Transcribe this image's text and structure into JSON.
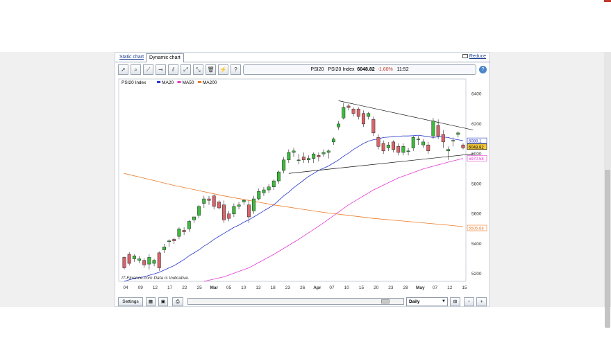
{
  "tabs": [
    {
      "label": "Static chart"
    },
    {
      "label": "Dynamic chart"
    }
  ],
  "reduce_label": "Reduce",
  "ticker": {
    "symbol": "PSI20",
    "name": "PSI20 Index",
    "price": "6048.82",
    "change": "-1.60%",
    "time": "11:52"
  },
  "bottom": {
    "settings_label": "Settings",
    "interval": "Daily"
  },
  "chart_data": {
    "type": "line",
    "legend": [
      "PSI20 Index",
      "MA20",
      "MA50",
      "MA200"
    ],
    "watermark": "IT-Finance.com Data is Indicative.",
    "colors": {
      "up": "#3dbb3d",
      "down": "#d9646a",
      "ma20": "#2535c8",
      "ma50": "#e23ad2",
      "ma200": "#ee7a25",
      "trend": "#111111"
    },
    "ylim": [
      5150,
      6500
    ],
    "yticks": [
      5200,
      5400,
      5600,
      5800,
      6000,
      6200,
      6400
    ],
    "xtick_labels": [
      "04",
      "09",
      "12",
      "17",
      "22",
      "25",
      "Mar",
      "05",
      "10",
      "13",
      "18",
      "23",
      "26",
      "Apr",
      "07",
      "10",
      "15",
      "20",
      "23",
      "28",
      "May",
      "07",
      "12",
      "15"
    ],
    "candles": [
      [
        5310,
        5240,
        5230,
        5315
      ],
      [
        5330,
        5270,
        5255,
        5345
      ],
      [
        5300,
        5320,
        5280,
        5330
      ],
      [
        5290,
        5300,
        5270,
        5320
      ],
      [
        5290,
        5260,
        5240,
        5305
      ],
      [
        5265,
        5310,
        5230,
        5330
      ],
      [
        5270,
        5290,
        5250,
        5300
      ],
      [
        5340,
        5240,
        5220,
        5350
      ],
      [
        5360,
        5380,
        5340,
        5400
      ],
      [
        5415,
        5420,
        5380,
        5430
      ],
      [
        5430,
        5420,
        5400,
        5440
      ],
      [
        5450,
        5500,
        5430,
        5510
      ],
      [
        5490,
        5480,
        5460,
        5510
      ],
      [
        5500,
        5550,
        5480,
        5560
      ],
      [
        5560,
        5580,
        5540,
        5580
      ],
      [
        5590,
        5650,
        5570,
        5660
      ],
      [
        5670,
        5700,
        5640,
        5720
      ],
      [
        5700,
        5690,
        5660,
        5720
      ],
      [
        5720,
        5650,
        5630,
        5730
      ],
      [
        5680,
        5640,
        5630,
        5690
      ],
      [
        5660,
        5560,
        5540,
        5690
      ],
      [
        5600,
        5570,
        5550,
        5620
      ],
      [
        5600,
        5650,
        5580,
        5670
      ],
      [
        5650,
        5660,
        5630,
        5680
      ],
      [
        5680,
        5690,
        5660,
        5700
      ],
      [
        5660,
        5580,
        5540,
        5690
      ],
      [
        5620,
        5700,
        5600,
        5720
      ],
      [
        5700,
        5750,
        5690,
        5770
      ],
      [
        5740,
        5760,
        5720,
        5780
      ],
      [
        5760,
        5780,
        5740,
        5800
      ],
      [
        5780,
        5820,
        5760,
        5830
      ],
      [
        5820,
        5880,
        5800,
        5890
      ],
      [
        5890,
        5960,
        5870,
        5980
      ],
      [
        5960,
        6010,
        5940,
        6030
      ],
      [
        6010,
        6020,
        5980,
        6040
      ],
      [
        5960,
        5960,
        5930,
        6000
      ],
      [
        5980,
        5960,
        5940,
        6010
      ],
      [
        5960,
        5970,
        5940,
        5990
      ],
      [
        5970,
        6000,
        5940,
        6010
      ],
      [
        5990,
        5980,
        5950,
        6010
      ],
      [
        6000,
        6010,
        5980,
        6030
      ],
      [
        6010,
        6020,
        5970,
        6030
      ],
      [
        6080,
        6100,
        6060,
        6110
      ],
      [
        6180,
        6200,
        6160,
        6220
      ],
      [
        6240,
        6310,
        6230,
        6340
      ],
      [
        6320,
        6310,
        6290,
        6335
      ],
      [
        6300,
        6270,
        6250,
        6310
      ],
      [
        6300,
        6250,
        6230,
        6310
      ],
      [
        6270,
        6200,
        6180,
        6290
      ],
      [
        6250,
        6270,
        6230,
        6280
      ],
      [
        6230,
        6140,
        6120,
        6250
      ],
      [
        6110,
        6050,
        6030,
        6130
      ],
      [
        6070,
        6020,
        6000,
        6090
      ],
      [
        6040,
        6060,
        6020,
        6080
      ],
      [
        6080,
        6030,
        6010,
        6090
      ],
      [
        6050,
        6010,
        5990,
        6070
      ],
      [
        6010,
        6050,
        5990,
        6070
      ],
      [
        6020,
        6020,
        5990,
        6040
      ],
      [
        6040,
        6110,
        6020,
        6120
      ],
      [
        6100,
        6100,
        6060,
        6120
      ],
      [
        6060,
        6080,
        6040,
        6100
      ],
      [
        6060,
        6020,
        6000,
        6080
      ],
      [
        6120,
        6220,
        6100,
        6240
      ],
      [
        6190,
        6120,
        6100,
        6230
      ],
      [
        6130,
        6080,
        6040,
        6160
      ],
      [
        6020,
        6030,
        5960,
        6050
      ],
      [
        6090,
        6090,
        6050,
        6110
      ],
      [
        6130,
        6140,
        6110,
        6150
      ],
      [
        6060,
        6040,
        6030,
        6070
      ]
    ],
    "ma20": [
      5150,
      5160,
      5170,
      5175,
      5180,
      5190,
      5200,
      5210,
      5225,
      5240,
      5255,
      5275,
      5295,
      5320,
      5340,
      5360,
      5385,
      5405,
      5430,
      5450,
      5470,
      5490,
      5510,
      5525,
      5545,
      5560,
      5580,
      5600,
      5620,
      5640,
      5660,
      5690,
      5720,
      5745,
      5775,
      5800,
      5825,
      5850,
      5870,
      5890,
      5905,
      5920,
      5940,
      5960,
      5985,
      6005,
      6030,
      6050,
      6070,
      6085,
      6095,
      6100,
      6110,
      6112,
      6115,
      6118,
      6120,
      6120,
      6122,
      6125,
      6120,
      6115,
      6110,
      6115,
      6112,
      6110,
      6100,
      6095,
      6088
    ],
    "ma50_x": [
      16,
      20,
      25,
      30,
      35,
      40,
      45,
      50,
      55,
      60,
      65,
      68
    ],
    "ma50": [
      5150,
      5180,
      5240,
      5330,
      5430,
      5540,
      5660,
      5760,
      5840,
      5900,
      5945,
      5970
    ],
    "ma200_x": [
      0,
      5,
      10,
      15,
      20,
      25,
      30,
      35,
      40,
      45,
      50,
      55,
      60,
      65,
      68
    ],
    "ma200": [
      5870,
      5830,
      5790,
      5755,
      5720,
      5690,
      5660,
      5635,
      5610,
      5590,
      5570,
      5555,
      5540,
      5525,
      5515
    ],
    "price_labels": [
      {
        "text": "6088.1",
        "value": 6088,
        "color": "#2535c8",
        "bg": "#ffffff"
      },
      {
        "text": "6048.82",
        "value": 6048,
        "color": "#000000",
        "bg": "#f4c93a"
      },
      {
        "text": "5970.58",
        "value": 5971,
        "color": "#e23ad2",
        "bg": "#ffffff"
      },
      {
        "text": "5505.68",
        "value": 5506,
        "color": "#ee7a25",
        "bg": "#ffffff"
      }
    ],
    "trendlines": [
      [
        [
          43,
          6355
        ],
        [
          70,
          6160
        ]
      ],
      [
        [
          33,
          5870
        ],
        [
          70,
          6000
        ]
      ]
    ]
  }
}
